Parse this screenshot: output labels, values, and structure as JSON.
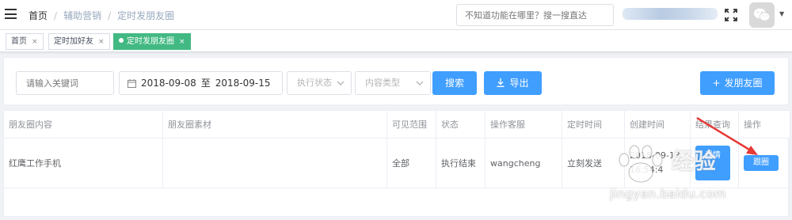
{
  "header": {
    "breadcrumb": [
      "首页",
      "辅助营销",
      "定时发朋友圈"
    ],
    "search_placeholder": "不知道功能在哪里？搜一搜直达"
  },
  "tags": [
    {
      "label": "首页",
      "active": false
    },
    {
      "label": "定时加好友",
      "active": false
    },
    {
      "label": "定时发朋友圈",
      "active": true
    }
  ],
  "filters": {
    "keyword_placeholder": "请输入关键词",
    "date_start": "2018-09-08",
    "date_sep": "至",
    "date_end": "2018-09-15",
    "status_placeholder": "执行状态",
    "content_type_placeholder": "内容类型",
    "search_label": "搜索",
    "export_label": "导出",
    "post_label": "发朋友圈"
  },
  "table": {
    "columns": [
      "朋友圈内容",
      "朋友圈素材",
      "可见范围",
      "状态",
      "操作客服",
      "定时时间",
      "创建时间",
      "结果查询",
      "操作"
    ],
    "rows": [
      {
        "content": "红鹰工作手机",
        "material": "",
        "visibility": "全部",
        "status": "执行结束",
        "operator": "wangcheng",
        "schedule": "立刻发送",
        "created_line1": "2018-09-13",
        "created_line2": "16:54:4",
        "result_button": "详情",
        "action_button": "跟圈"
      }
    ]
  },
  "watermark": {
    "text": "经验",
    "url": "jingyan.baidu.com"
  }
}
